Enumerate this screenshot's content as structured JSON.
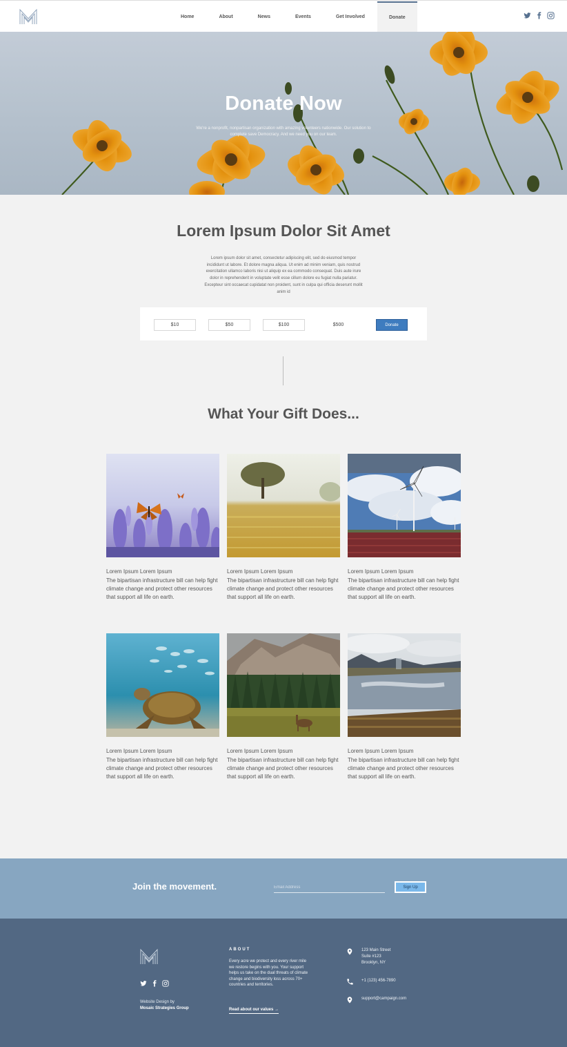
{
  "nav": {
    "items": [
      {
        "label": "Home"
      },
      {
        "label": "About"
      },
      {
        "label": "News"
      },
      {
        "label": "Events"
      },
      {
        "label": "Get Involved"
      },
      {
        "label": "Donate",
        "active": true
      }
    ],
    "social": [
      "twitter-icon",
      "facebook-icon",
      "instagram-icon"
    ]
  },
  "hero": {
    "title": "Donate Now",
    "subtitle": "We're a nonprofit, nonpartisan organization with amazing volunteers nationwide. Our solution to complete save Democracy. And we need you on our team."
  },
  "intro": {
    "title": "Lorem Ipsum Dolor Sit Amet",
    "text": "Lorem ipsum dolor sit amet, consectetur adipiscing elit, sed do eiusmod tempor incididunt ut labore. Et dolore magna aliqua. Ut enim ad minim veniam, quis nostrud exercitation ullamco laboris nisi ut aliquip ex ea commodo consequat. Duis aute irure dolor in reprehenderit in voluptate velit esse cillum dolore eu fugiat nulla pariatur. Excepteur sint occaecat cupidatat non proident, sunt in culpa qui officia deserunt mollit anim id"
  },
  "donation": {
    "amounts": [
      "$10",
      "$50",
      "$100",
      "$500"
    ],
    "button": "Donate"
  },
  "gifts": {
    "title": "What Your Gift Does...",
    "cards": [
      {
        "image": "butterfly-lavender-photo",
        "title": "Lorem Ipsum Lorem Ipsum",
        "body": "The bipartisan infrastructure bill can help fight climate change and protect other resources that support all life on earth."
      },
      {
        "image": "tree-field-photo",
        "title": "Lorem Ipsum Lorem Ipsum",
        "body": "The bipartisan infrastructure bill can help fight climate change and protect other resources that support all life on earth."
      },
      {
        "image": "wind-turbine-photo",
        "title": "Lorem Ipsum Lorem Ipsum",
        "body": "The bipartisan infrastructure bill can help fight climate change and protect other resources that support all life on earth."
      },
      {
        "image": "sea-turtle-photo",
        "title": "Lorem Ipsum Lorem Ipsum",
        "body": "The bipartisan infrastructure bill can help fight climate change and protect other resources that support all life on earth."
      },
      {
        "image": "mountain-deer-photo",
        "title": "Lorem Ipsum Lorem Ipsum",
        "body": "The bipartisan infrastructure bill can help fight climate change and protect other resources that support all life on earth."
      },
      {
        "image": "lake-wetland-photo",
        "title": "Lorem Ipsum Lorem Ipsum",
        "body": "The bipartisan infrastructure bill can help fight climate change and protect other resources that support all life on earth."
      }
    ]
  },
  "join": {
    "title": "Join the movement.",
    "email_placeholder": "Email Address",
    "button": "Sign Up"
  },
  "footer": {
    "credit_line1": "Website Design by",
    "credit_line2": "Mosaic Strategies Group",
    "about_heading": "ABOUT",
    "about_text": "Every acre we protect and every river mile we restore begins with you. Your support helps us take on the dual threats of climate change and biodiversity loss across 70+ countries and territories.",
    "about_link": "Read about our values →",
    "address_line1": "123 Main Street",
    "address_line2": "Suite #123",
    "address_line3": "Brooklyn, NY",
    "phone": "+1 (123) 456-7890",
    "email": "support@campaign.com"
  },
  "colors": {
    "accent": "#3e7cbf",
    "join_bg": "#87a6c1",
    "footer_bg": "#526883"
  }
}
